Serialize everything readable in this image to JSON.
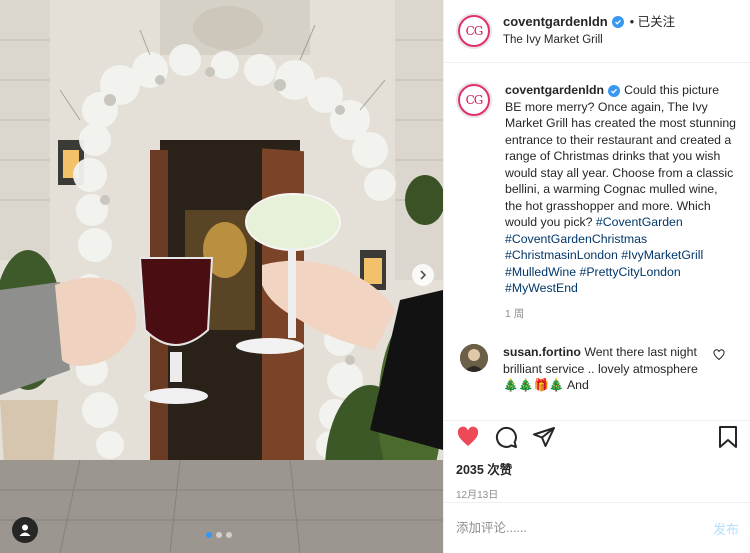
{
  "post": {
    "username": "coventgardenldn",
    "avatar_text": "CG",
    "follow_label": "• 已关注",
    "location": "The Ivy Market Grill",
    "caption": "Could this picture BE more merry? Once again, The Ivy Market Grill has created the most stunning entrance to their restaurant and created a range of Christmas drinks that you wish would stay all year. Choose from a classic bellini, a warming Cognac mulled wine, the hot grasshopper and more. Which would you pick?",
    "hashtags": [
      "#CoventGarden",
      "#CoventGardenChristmas",
      "#ChristmasinLondon",
      "#IvyMarketGrill",
      "#MulledWine",
      "#PrettyCityLondon",
      "#MyWestEnd"
    ],
    "caption_time": "1 周",
    "likes": "2035 次赞",
    "date": "12月13日"
  },
  "comment": {
    "username": "susan.fortino",
    "text": "Went there last night brilliant service .. lovely atmosphere",
    "emojis": "🎄🎄🎁🎄 And"
  },
  "add_comment": {
    "placeholder": "添加评论......",
    "post_label": "发布"
  },
  "carousel": {
    "slides": 3,
    "active": 1
  },
  "icons": {
    "verified": "verified-badge-icon",
    "like": "heart-filled-icon",
    "comment": "comment-icon",
    "share": "paper-plane-icon",
    "save": "bookmark-icon",
    "comment_like": "heart-outline-icon",
    "next": "chevron-right-icon",
    "tags": "user-tag-icon"
  },
  "colors": {
    "like": "#ed4956",
    "verified": "#3897f0",
    "hashtag": "#00376b",
    "post_button": "#b2dffc"
  }
}
